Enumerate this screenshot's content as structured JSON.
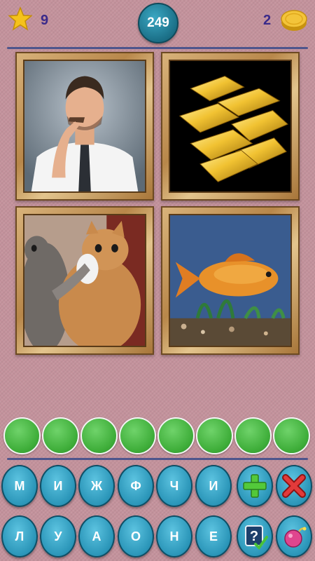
{
  "header": {
    "stars": "9",
    "level": "249",
    "coins": "2"
  },
  "pictures": [
    {
      "icon": "man-mustache-gesture"
    },
    {
      "icon": "gold-bars"
    },
    {
      "icon": "cats-shushing"
    },
    {
      "icon": "goldfish"
    }
  ],
  "answer_slots": [
    "",
    "",
    "",
    "",
    "",
    "",
    "",
    ""
  ],
  "keyboard": {
    "row1": [
      "М",
      "И",
      "Ж",
      "Ф",
      "Ч",
      "И"
    ],
    "row2": [
      "Л",
      "У",
      "А",
      "О",
      "Н",
      "Е"
    ],
    "actions": {
      "add": "plus-icon",
      "remove": "cross-icon",
      "hint": "question-check-icon",
      "bomb": "bomb-icon"
    }
  },
  "colors": {
    "background": "#c4929c",
    "key": "#2a95b8",
    "slot": "#3fae3a",
    "accent": "#3a4a8a"
  }
}
